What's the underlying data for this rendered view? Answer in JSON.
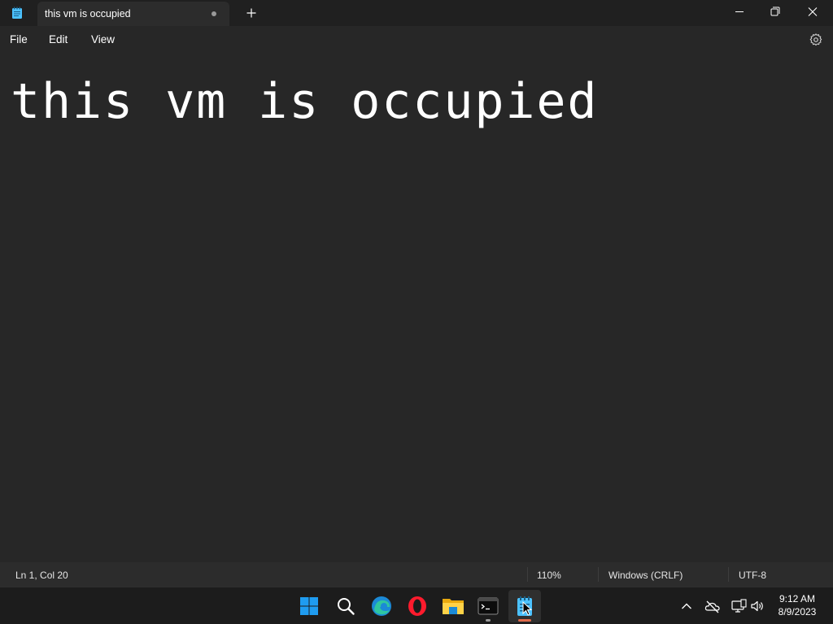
{
  "window": {
    "tab_title": "this vm is occupied",
    "app_icon": "notepad-icon",
    "new_tab_icon": "plus-icon",
    "controls": [
      "minimize-icon",
      "restore-icon",
      "close-icon"
    ]
  },
  "menu": {
    "file": "File",
    "edit": "Edit",
    "view": "View",
    "settings_icon": "gear-icon"
  },
  "editor": {
    "content": "this vm is occupied"
  },
  "status": {
    "position": "Ln 1, Col 20",
    "zoom": "110%",
    "line_ending": "Windows (CRLF)",
    "encoding": "UTF-8"
  },
  "taskbar": {
    "apps": [
      "windows-start-icon",
      "search-icon",
      "edge-browser-icon",
      "opera-browser-icon",
      "file-explorer-icon",
      "terminal-icon",
      "notepad-icon"
    ],
    "active_app": "notepad-icon",
    "tray": [
      "chevron-up-icon",
      "onedrive-offline-icon",
      "network-icon",
      "volume-icon"
    ],
    "time": "9:12 AM",
    "date": "8/9/2023"
  },
  "colors": {
    "accent": "#0078d4",
    "active_indicator": "#e06a4a",
    "background": "#272727"
  }
}
